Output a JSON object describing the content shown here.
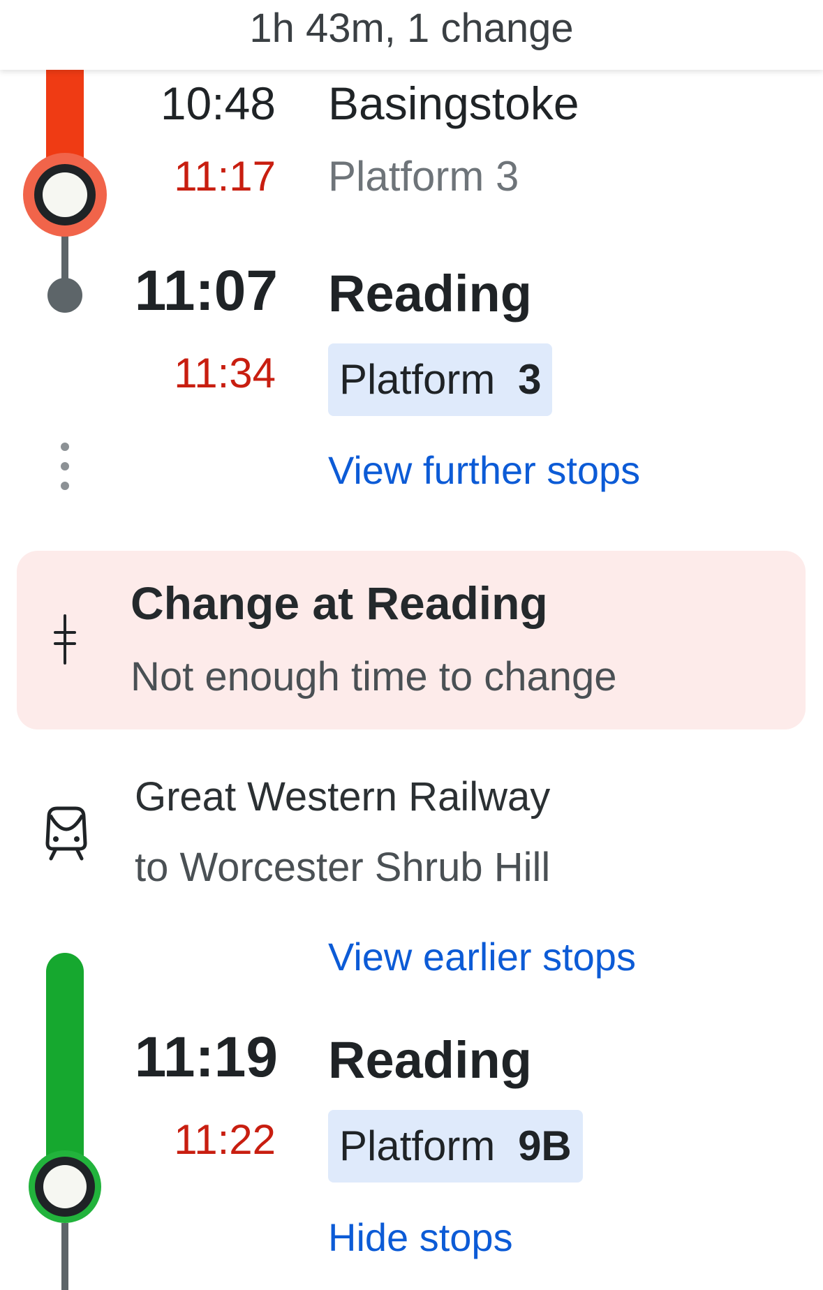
{
  "header": {
    "summary": "1h 43m, 1 change"
  },
  "leg1": {
    "previous_stop": {
      "scheduled": "10:48",
      "expected": "11:17",
      "station": "Basingstoke",
      "platform": "Platform 3"
    },
    "alight_stop": {
      "scheduled": "11:07",
      "expected": "11:34",
      "station": "Reading",
      "platform_label": "Platform",
      "platform_number": "3"
    },
    "view_further_stops": "View further stops",
    "line_color": "#ef3b14"
  },
  "change": {
    "title": "Change at Reading",
    "warning": "Not enough time to change",
    "icon": "change-icon"
  },
  "leg2": {
    "operator": "Great Western Railway",
    "destination": "to Worcester Shrub Hill",
    "icon": "train-icon",
    "view_earlier_stops": "View earlier stops",
    "board_stop": {
      "scheduled": "11:19",
      "expected": "11:22",
      "station": "Reading",
      "platform_label": "Platform",
      "platform_number": "9B"
    },
    "hide_stops": "Hide stops",
    "line_color": "#16a82f"
  },
  "colors": {
    "delay": "#c81e10",
    "link": "#0c5bd6",
    "platform_badge": "#dfeafb",
    "change_card": "#fdebea"
  }
}
